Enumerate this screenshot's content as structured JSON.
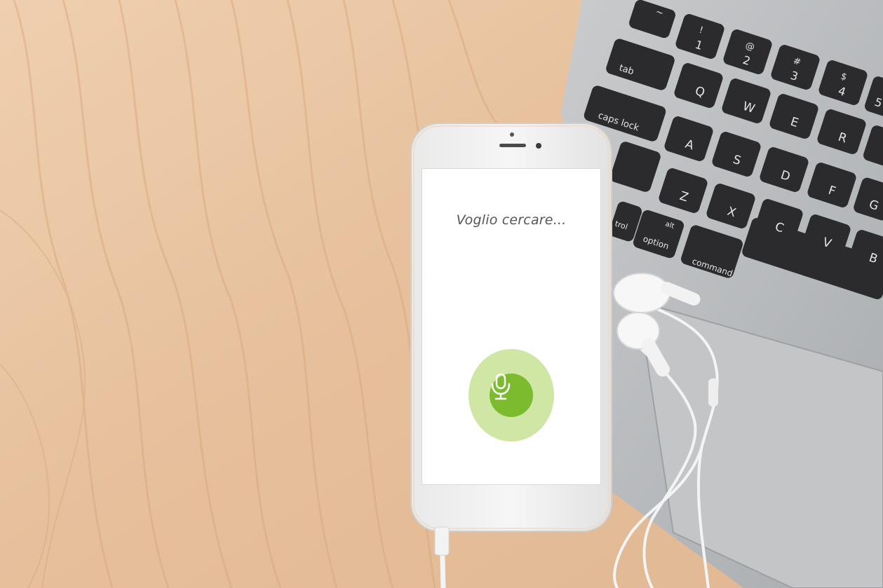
{
  "screen": {
    "prompt_text": "Voglio cercare...",
    "mic_icon": "microphone-icon"
  },
  "keyboard": {
    "keys": [
      "~",
      "!",
      "@",
      "#",
      "$",
      "1",
      "2",
      "3",
      "4",
      "5",
      "tab",
      "Q",
      "W",
      "E",
      "R",
      "caps lock",
      "A",
      "S",
      "D",
      "F",
      "G",
      "Z",
      "X",
      "C",
      "V",
      "B",
      "alt",
      "option",
      "command",
      "trol"
    ]
  },
  "colors": {
    "wood": "#e8c3a0",
    "mic_outer": "#cfe6a4",
    "mic_inner": "#7cbb2e",
    "laptop_body": "#b9bcbf",
    "key": "#2b2b2d"
  }
}
